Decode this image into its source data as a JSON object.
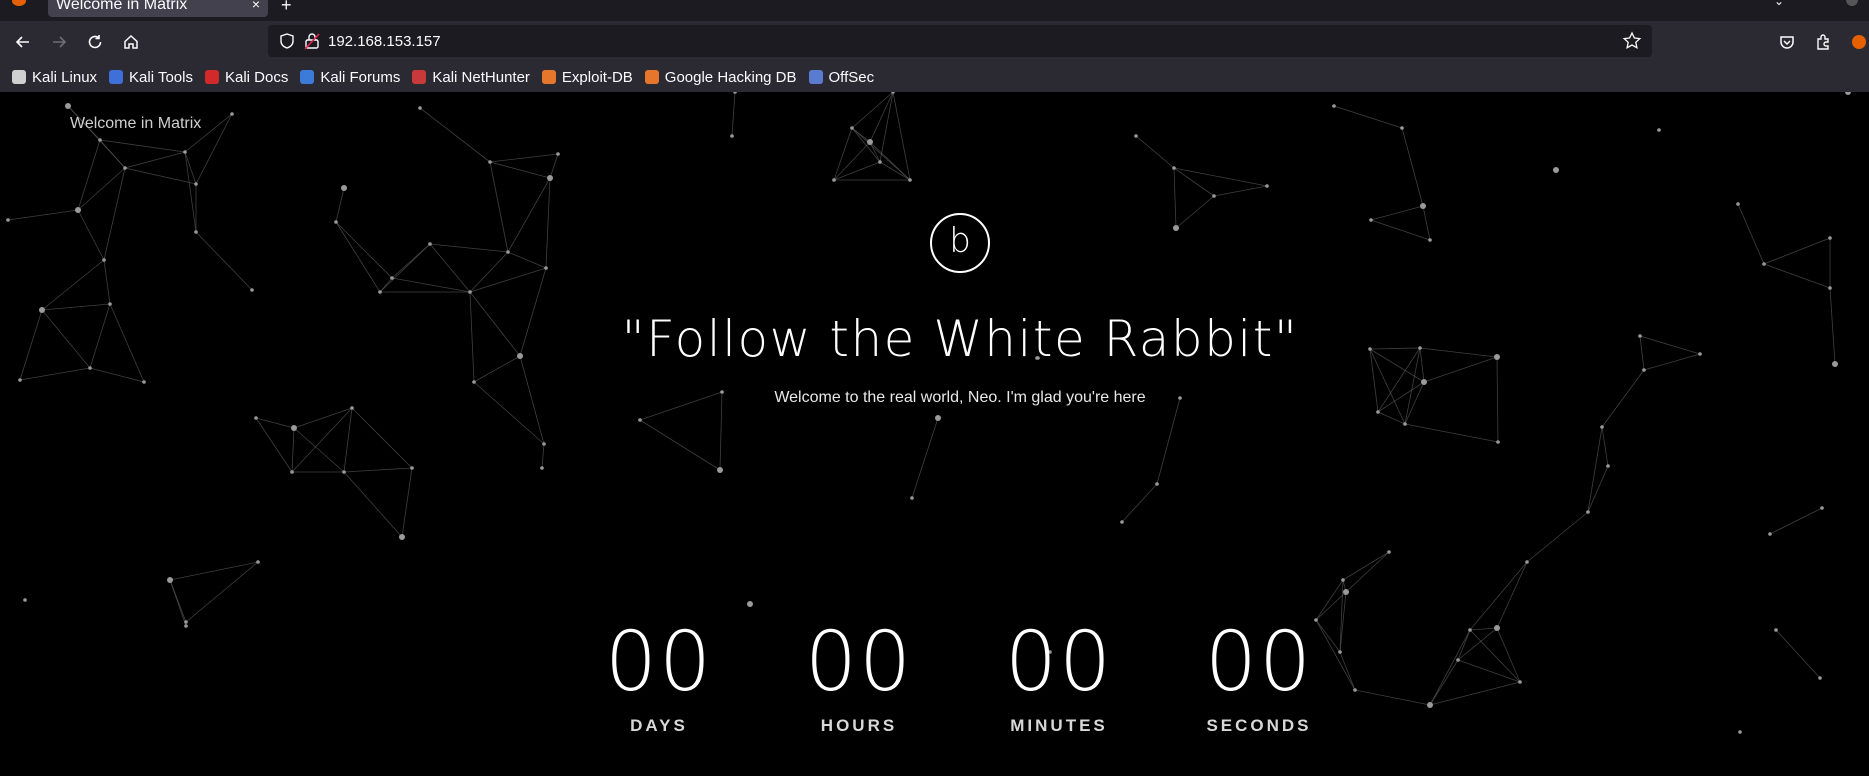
{
  "browser": {
    "tab_title": "Welcome in Matrix",
    "tab_close": "×",
    "new_tab": "+",
    "url": "192.168.153.157",
    "bookmarks": [
      {
        "label": "Kali Linux",
        "icon": "kali-dragon-icon",
        "color": "#d0d0d0"
      },
      {
        "label": "Kali Tools",
        "icon": "kali-tools-icon",
        "color": "#3f6fd8"
      },
      {
        "label": "Kali Docs",
        "icon": "kali-docs-icon",
        "color": "#d22a2a"
      },
      {
        "label": "Kali Forums",
        "icon": "kali-forums-icon",
        "color": "#3d7bd9"
      },
      {
        "label": "Kali NetHunter",
        "icon": "kali-nethunter-icon",
        "color": "#c83a3a"
      },
      {
        "label": "Exploit-DB",
        "icon": "exploit-db-icon",
        "color": "#e5762b"
      },
      {
        "label": "Google Hacking DB",
        "icon": "ghdb-icon",
        "color": "#e5762b"
      },
      {
        "label": "OffSec",
        "icon": "offsec-icon",
        "color": "#5a7bd0"
      }
    ]
  },
  "page": {
    "site_name": "Welcome in Matrix",
    "logo_letter": "b",
    "headline": "\"Follow the White Rabbit\"",
    "subtext": "Welcome to the real world, Neo. I'm glad you're here",
    "countdown": [
      {
        "value": "00",
        "label": "DAYS"
      },
      {
        "value": "00",
        "label": "HOURS"
      },
      {
        "value": "00",
        "label": "MINUTES"
      },
      {
        "value": "00",
        "label": "SECONDS"
      }
    ]
  }
}
